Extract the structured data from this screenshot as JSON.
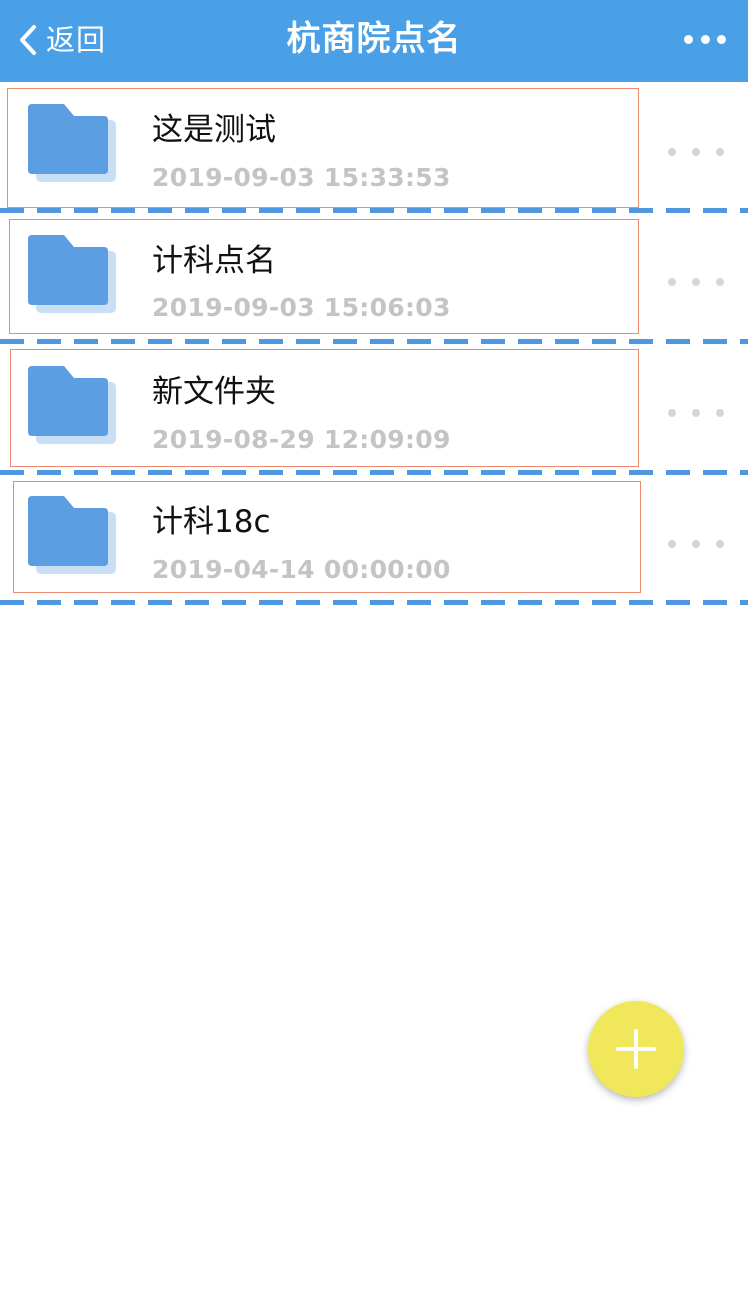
{
  "navbar": {
    "back_label": "返回",
    "title": "杭商院点名",
    "back_icon": "chevron-left-icon",
    "more_icon": "more-horizontal-icon",
    "background_color": "#4aa0e6"
  },
  "folders": [
    {
      "name": "这是测试",
      "date": "2019-09-03 15:33:53",
      "icon": "folder-icon"
    },
    {
      "name": "计科点名",
      "date": "2019-09-03 15:06:03",
      "icon": "folder-icon"
    },
    {
      "name": "新文件夹",
      "date": "2019-08-29 12:09:09",
      "icon": "folder-icon"
    },
    {
      "name": "计科18c",
      "date": "2019-04-14 00:00:00",
      "icon": "folder-icon"
    }
  ],
  "fab": {
    "icon": "plus-icon",
    "color": "#f0e85a"
  },
  "colors": {
    "folder": "#5b9fe2",
    "folder_back": "#c9dff5",
    "divider": "#4f97de",
    "highlight_border": "#ec8a72"
  }
}
